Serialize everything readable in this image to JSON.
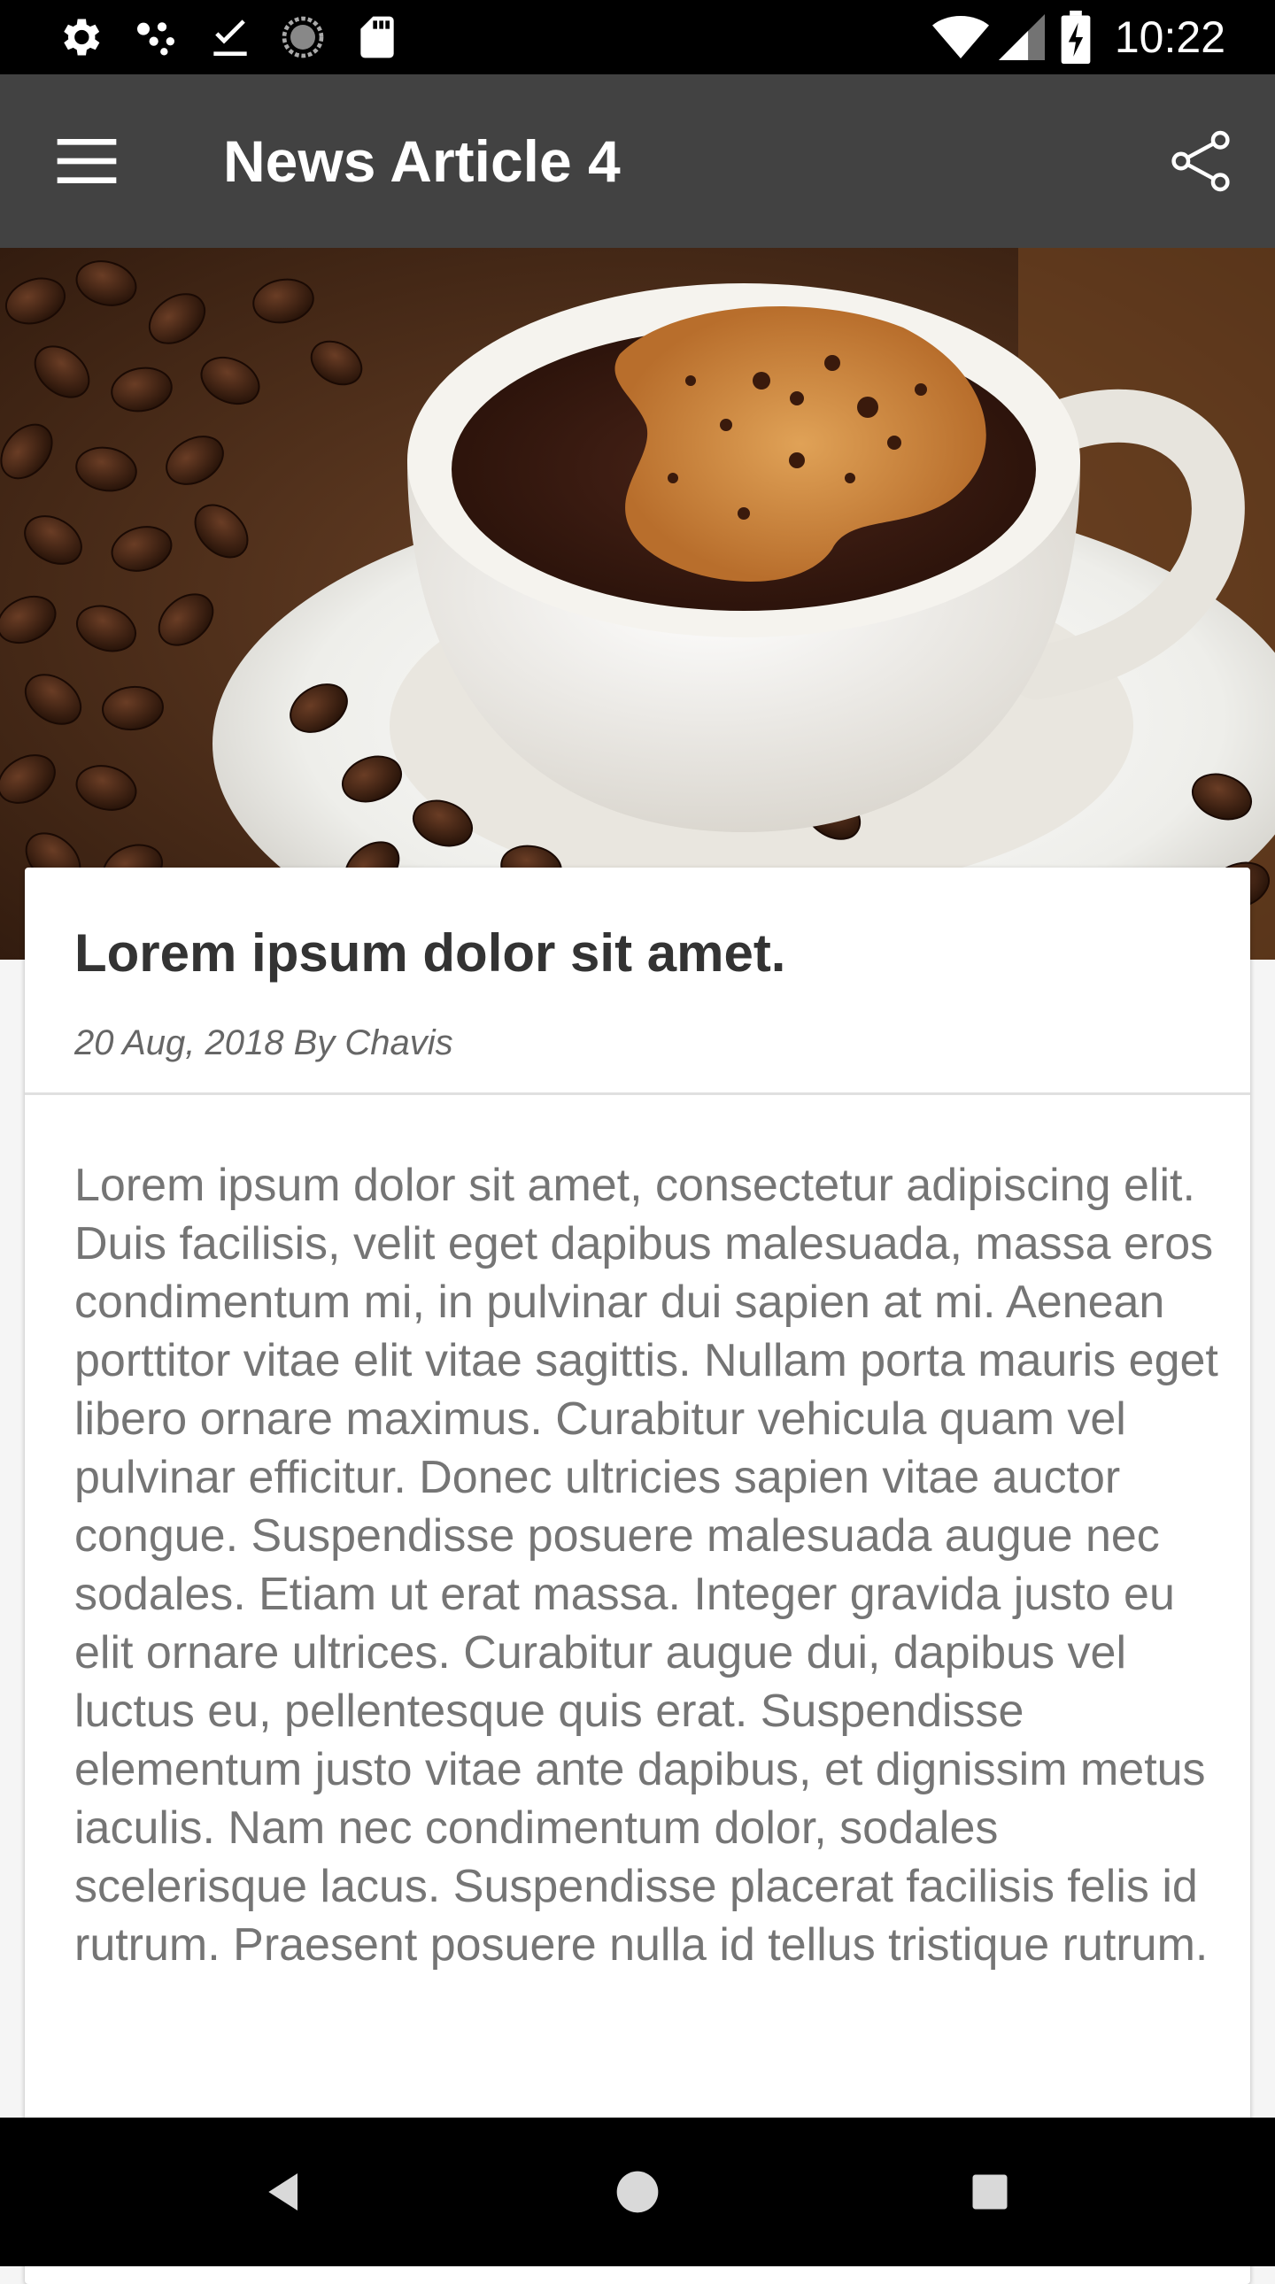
{
  "status_bar": {
    "time": "10:22",
    "icons": [
      "settings-icon",
      "dots-icon",
      "download-done-icon",
      "sync-icon",
      "sd-card-icon",
      "wifi-icon",
      "signal-icon",
      "battery-charging-icon"
    ]
  },
  "app_bar": {
    "title": "News Article 4",
    "menu_icon": "hamburger-menu-icon",
    "share_icon": "share-icon"
  },
  "hero": {
    "image": "coffee-cup-with-beans-photo"
  },
  "article": {
    "title": "Lorem ipsum dolor sit amet.",
    "meta": "20 Aug, 2018 By Chavis",
    "body": "Lorem ipsum dolor sit amet, consectetur adipiscing elit. Duis facilisis, velit eget dapibus malesuada, massa eros condimentum mi, in pulvinar dui sapien at mi. Aenean porttitor vitae elit vitae sagittis. Nullam porta mauris eget libero ornare maximus. Curabitur vehicula quam vel pulvinar efficitur. Donec ultricies sapien vitae auctor congue. Suspendisse posuere malesuada augue nec sodales. Etiam ut erat massa. Integer gravida justo eu elit ornare ultrices. Curabitur augue dui, dapibus vel luctus eu, pellentesque quis erat. Suspendisse elementum justo vitae ante dapibus, et dignissim metus iaculis. Nam nec condimentum dolor, sodales scelerisque lacus. Suspendisse placerat facilisis felis id rutrum. Praesent posuere nulla id tellus tristique rutrum."
  },
  "nav_bar": {
    "icons": [
      "back-icon",
      "home-icon",
      "recents-icon"
    ]
  },
  "colors": {
    "app_bar": "#424242",
    "status_bar": "#000000",
    "card_bg": "#ffffff",
    "page_bg": "#f5f5f5"
  }
}
